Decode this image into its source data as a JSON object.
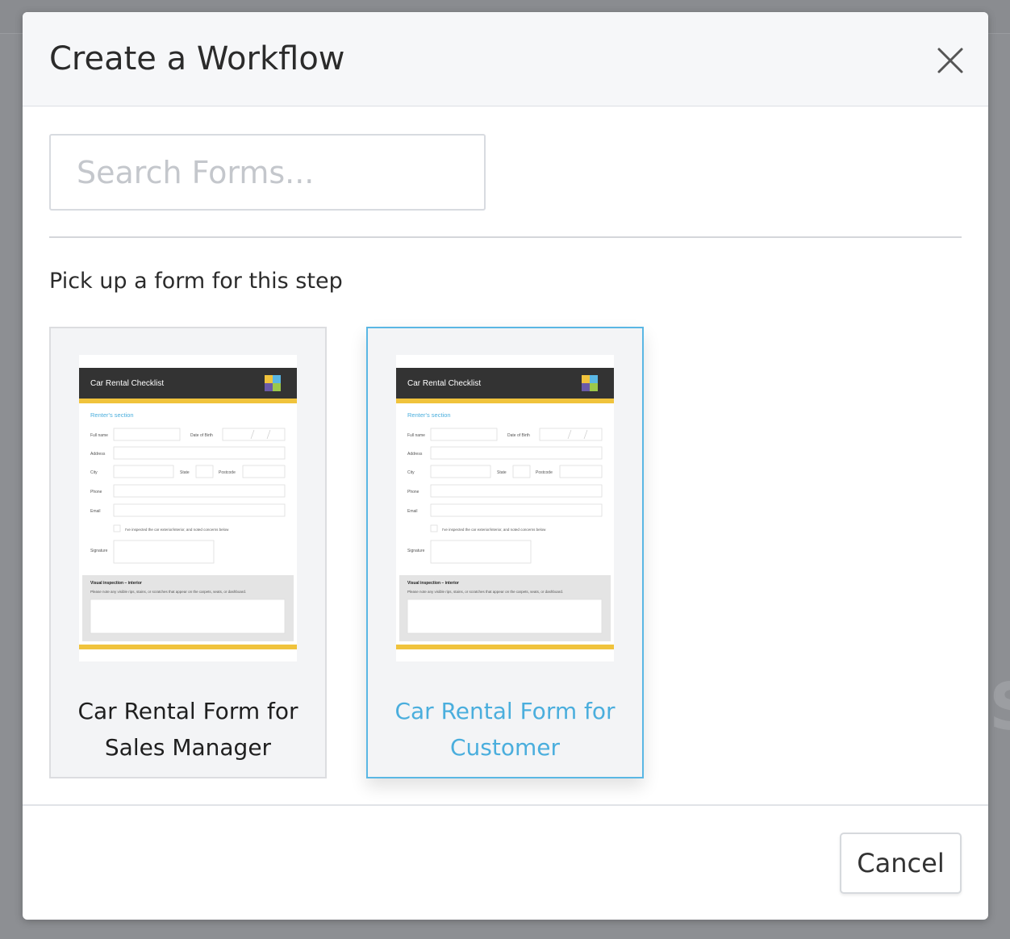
{
  "modal": {
    "title": "Create a Workflow",
    "close_icon": "close-icon"
  },
  "search": {
    "placeholder": "Search Forms...",
    "value": ""
  },
  "section_label": "Pick up a form for this step",
  "forms": [
    {
      "label": "Car Rental Form for Sales Manager",
      "selected": false,
      "thumbnail": {
        "header": "Car Rental Checklist",
        "section": "Renter's section",
        "fields": [
          "Full name",
          "Date of Birth",
          "Address",
          "City",
          "State",
          "Postcode",
          "Phone",
          "Email",
          "Signature"
        ],
        "checkbox_text": "I've inspected the car exterior/interior, and noted concerns below",
        "panel_title": "Visual inspection – interior",
        "panel_text": "Please note any visible rips, stains, or scratches that appear on the carpets, seats, or dashboard."
      }
    },
    {
      "label": "Car Rental Form for Customer",
      "selected": true,
      "thumbnail": {
        "header": "Car Rental Checklist",
        "section": "Renter's section",
        "fields": [
          "Full name",
          "Date of Birth",
          "Address",
          "City",
          "State",
          "Postcode",
          "Phone",
          "Email",
          "Signature"
        ],
        "checkbox_text": "I've inspected the car exterior/interior, and noted concerns below",
        "panel_title": "Visual inspection – interior",
        "panel_text": "Please note any visible rips, stains, or scratches that appear on the carpets, seats, or dashboard."
      }
    }
  ],
  "footer": {
    "cancel_label": "Cancel"
  },
  "colors": {
    "accent": "#4aaedd",
    "thumb_header": "#333333",
    "thumb_stripe": "#f0c33c",
    "thumb_section": "#4aaedd"
  }
}
